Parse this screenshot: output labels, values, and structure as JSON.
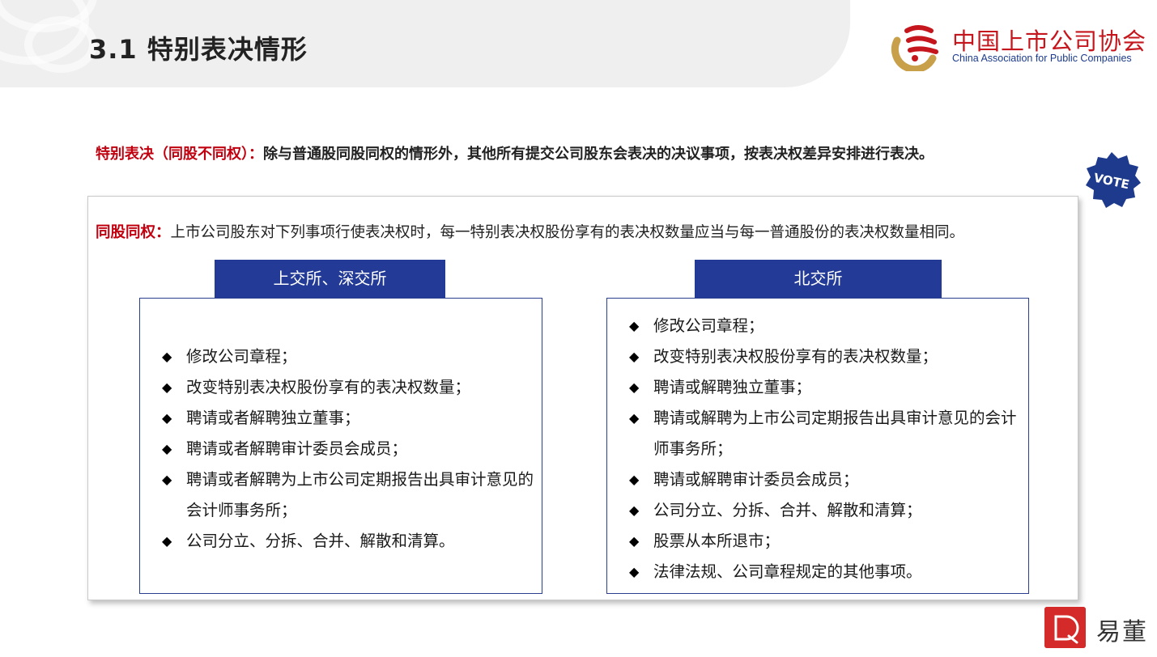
{
  "header": {
    "title": "3.1 特别表决情形"
  },
  "logo": {
    "cn": "中国上市公司协会",
    "en": "China Association for Public Companies"
  },
  "intro": {
    "label": "特别表决（同股不同权）：",
    "text": "除与普通股同股同权的情形外，其他所有提交公司股东会表决的决议事项，按表决权差异安排进行表决。"
  },
  "badge": {
    "icon": "vote-badge-icon",
    "text": "VOTE"
  },
  "same_rights": {
    "label": "同股同权：",
    "text": "上市公司股东对下列事项行使表决权时，每一特别表决权股份享有的表决权数量应当与每一普通股份的表决权数量相同。"
  },
  "columns": [
    {
      "title": "上交所、深交所",
      "items": [
        "修改公司章程；",
        "改变特别表决权股份享有的表决权数量；",
        "聘请或者解聘独立董事；",
        "聘请或者解聘审计委员会成员；",
        "聘请或者解聘为上市公司定期报告出具审计意见的会计师事务所；",
        "公司分立、分拆、合并、解散和清算。"
      ]
    },
    {
      "title": "北交所",
      "items": [
        "修改公司章程；",
        "改变特别表决权股份享有的表决权数量；",
        "聘请或解聘独立董事；",
        "聘请或解聘为上市公司定期报告出具审计意见的会计师事务所；",
        "聘请或解聘审计委员会成员；",
        "公司分立、分拆、合并、解散和清算；",
        "股票从本所退市；",
        "法律法规、公司章程规定的其他事项。"
      ]
    }
  ],
  "bullet_symbol": "◆",
  "brand": {
    "name": "易董",
    "icon": "yidong-logo-icon"
  },
  "colors": {
    "accent_red": "#c0000f",
    "header_blue": "#233a96",
    "logo_red": "#c4161c",
    "logo_gold": "#c9a04a"
  }
}
